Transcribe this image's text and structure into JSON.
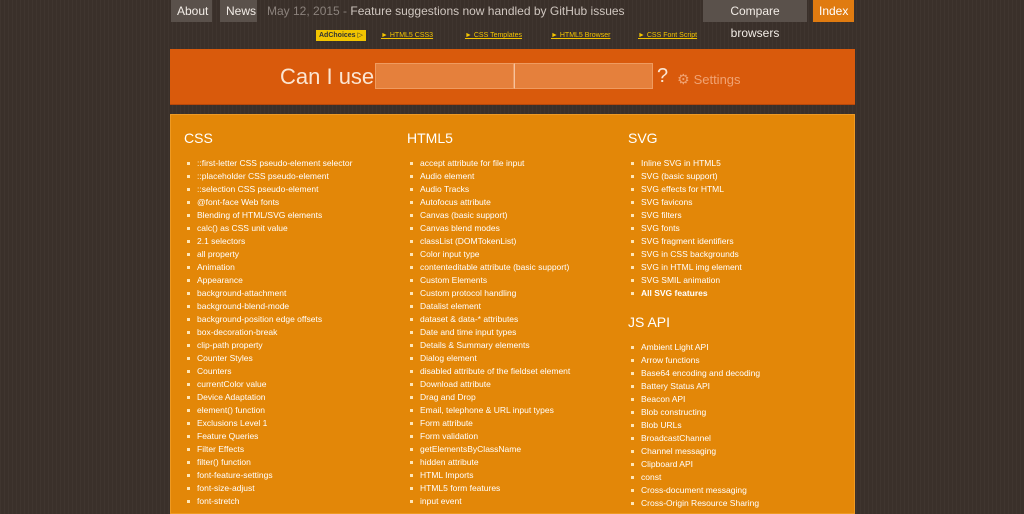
{
  "nav": {
    "about": "About",
    "news": "News",
    "notice_date": "May 12, 2015",
    "notice_sep": " - ",
    "notice_text": "Feature suggestions now handled by GitHub issues",
    "compare": "Compare browsers",
    "index": "Index"
  },
  "ads": {
    "adchoices": "AdChoices ▷",
    "links": [
      "► HTML5 CSS3",
      "► CSS Templates",
      "► HTML5 Browser",
      "► CSS Font Script"
    ]
  },
  "search": {
    "label": "Can I use",
    "qmark": "?",
    "settings": "Settings",
    "value": ""
  },
  "columns": {
    "css": {
      "title": "CSS",
      "items": [
        "::first-letter CSS pseudo-element selector",
        "::placeholder CSS pseudo-element",
        "::selection CSS pseudo-element",
        "@font-face Web fonts",
        "Blending of HTML/SVG elements",
        "calc() as CSS unit value",
        "2.1 selectors",
        "all property",
        "Animation",
        "Appearance",
        "background-attachment",
        "background-blend-mode",
        "background-position edge offsets",
        "box-decoration-break",
        "clip-path property",
        "Counter Styles",
        "Counters",
        "currentColor value",
        "Device Adaptation",
        "element() function",
        "Exclusions Level 1",
        "Feature Queries",
        "Filter Effects",
        "filter() function",
        "font-feature-settings",
        "font-size-adjust",
        "font-stretch"
      ]
    },
    "html5": {
      "title": "HTML5",
      "items": [
        "accept attribute for file input",
        "Audio element",
        "Audio Tracks",
        "Autofocus attribute",
        "Canvas (basic support)",
        "Canvas blend modes",
        "classList (DOMTokenList)",
        "Color input type",
        "contenteditable attribute (basic support)",
        "Custom Elements",
        "Custom protocol handling",
        "Datalist element",
        "dataset & data-* attributes",
        "Date and time input types",
        "Details & Summary elements",
        "Dialog element",
        "disabled attribute of the fieldset element",
        "Download attribute",
        "Drag and Drop",
        "Email, telephone & URL input types",
        "Form attribute",
        "Form validation",
        "getElementsByClassName",
        "hidden attribute",
        "HTML Imports",
        "HTML5 form features",
        "input event"
      ]
    },
    "svg": {
      "title": "SVG",
      "items": [
        "Inline SVG in HTML5",
        "SVG (basic support)",
        "SVG effects for HTML",
        "SVG favicons",
        "SVG filters",
        "SVG fonts",
        "SVG fragment identifiers",
        "SVG in CSS backgrounds",
        "SVG in HTML img element",
        "SVG SMIL animation"
      ],
      "all_label": "All SVG features"
    },
    "jsapi": {
      "title": "JS API",
      "items": [
        "Ambient Light API",
        "Arrow functions",
        "Base64 encoding and decoding",
        "Battery Status API",
        "Beacon API",
        "Blob constructing",
        "Blob URLs",
        "BroadcastChannel",
        "Channel messaging",
        "Clipboard API",
        "const",
        "Cross-document messaging",
        "Cross-Origin Resource Sharing"
      ]
    }
  }
}
